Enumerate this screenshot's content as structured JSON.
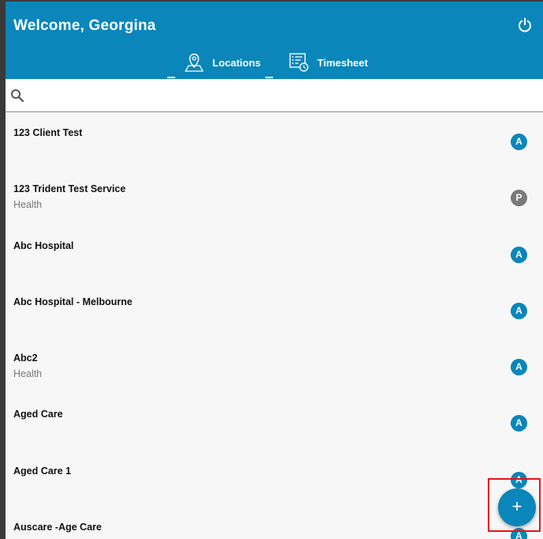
{
  "header": {
    "title": "Welcome, Georgina",
    "power_icon": "power-icon",
    "tabs": [
      {
        "label": "Locations",
        "icon": "map-pin-icon"
      },
      {
        "label": "Timesheet",
        "icon": "timesheet-icon"
      }
    ]
  },
  "search": {
    "placeholder": "",
    "value": "",
    "icon": "search-icon"
  },
  "locations": [
    {
      "name": "123 Client Test",
      "subtitle": "",
      "badge": "A"
    },
    {
      "name": "123 Trident Test Service",
      "subtitle": "Health",
      "badge": "P"
    },
    {
      "name": "Abc Hospital",
      "subtitle": "",
      "badge": "A"
    },
    {
      "name": "Abc Hospital - Melbourne",
      "subtitle": "",
      "badge": "A"
    },
    {
      "name": "Abc2",
      "subtitle": "Health",
      "badge": "A"
    },
    {
      "name": "Aged Care",
      "subtitle": "",
      "badge": "A"
    },
    {
      "name": "Aged Care 1",
      "subtitle": "",
      "badge": "A"
    },
    {
      "name": "Auscare -Age Care",
      "subtitle": "",
      "badge": "A"
    }
  ],
  "fab": {
    "label": "+",
    "icon": "plus-icon"
  },
  "colors": {
    "primary": "#0a86ba",
    "badge_pending": "#7a7a7a",
    "highlight": "#e8141a",
    "background": "#f7f7f7"
  }
}
